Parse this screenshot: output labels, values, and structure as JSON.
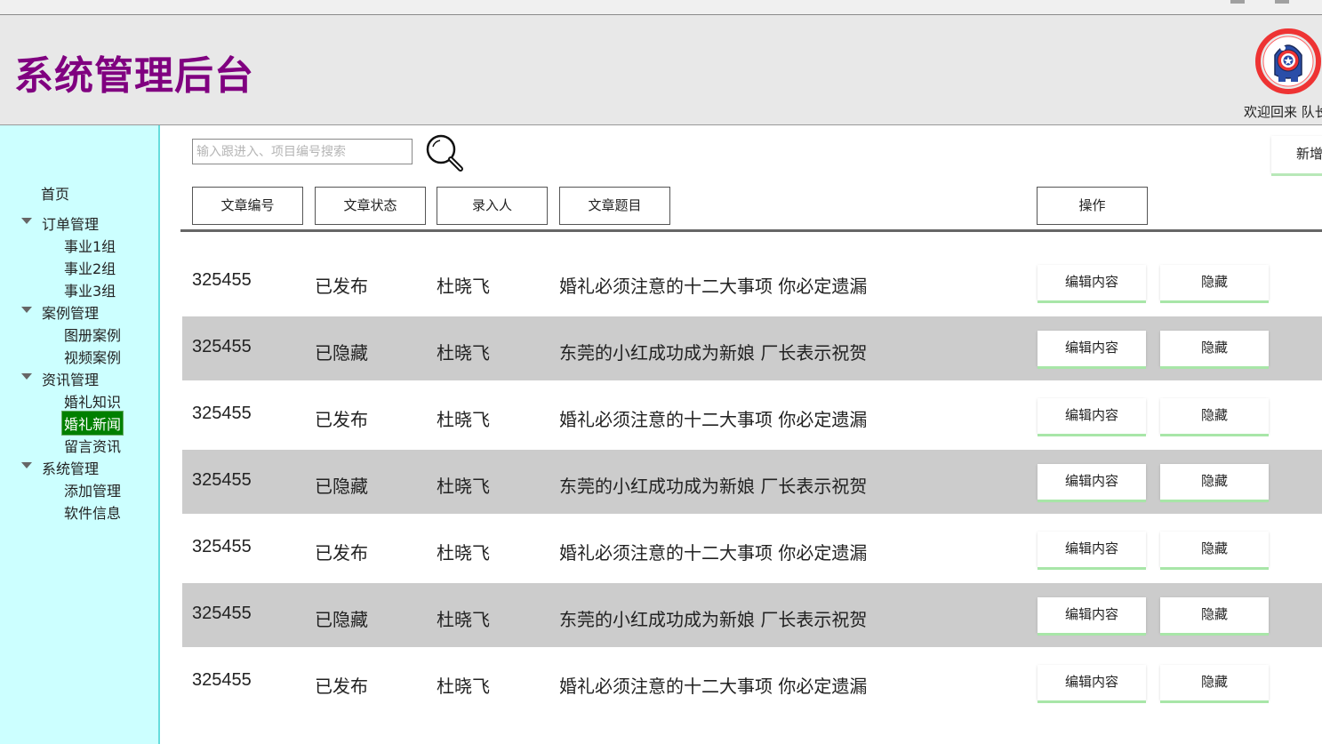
{
  "header": {
    "title": "系统管理后台",
    "welcome": "欢迎回来 队长"
  },
  "sidebar": {
    "home": "首页",
    "groups": [
      {
        "label": "订单管理",
        "items": [
          "事业1组",
          "事业2组",
          "事业3组"
        ]
      },
      {
        "label": "案例管理",
        "items": [
          "图册案例",
          "视频案例"
        ]
      },
      {
        "label": "资讯管理",
        "items": [
          "婚礼知识",
          "婚礼新闻",
          "留言资讯"
        ]
      },
      {
        "label": "系统管理",
        "items": [
          "添加管理",
          "软件信息"
        ]
      }
    ],
    "active_item": "婚礼新闻"
  },
  "search": {
    "placeholder": "输入跟进入、项目编号搜索",
    "value": ""
  },
  "toolbar": {
    "add_label": "新增"
  },
  "table": {
    "headers": [
      "文章编号",
      "文章状态",
      "录入人",
      "文章题目"
    ],
    "action_header": "操作",
    "edit_label": "编辑内容",
    "hide_label": "隐藏",
    "rows": [
      {
        "id": "325455",
        "status": "已发布",
        "author": "杜晓飞",
        "title": "婚礼必须注意的十二大事项 你必定遗漏"
      },
      {
        "id": "325455",
        "status": "已隐藏",
        "author": "杜晓飞",
        "title": "东莞的小红成功成为新娘 厂长表示祝贺"
      },
      {
        "id": "325455",
        "status": "已发布",
        "author": "杜晓飞",
        "title": "婚礼必须注意的十二大事项 你必定遗漏"
      },
      {
        "id": "325455",
        "status": "已隐藏",
        "author": "杜晓飞",
        "title": "东莞的小红成功成为新娘 厂长表示祝贺"
      },
      {
        "id": "325455",
        "status": "已发布",
        "author": "杜晓飞",
        "title": "婚礼必须注意的十二大事项 你必定遗漏"
      },
      {
        "id": "325455",
        "status": "已隐藏",
        "author": "杜晓飞",
        "title": "东莞的小红成功成为新娘 厂长表示祝贺"
      },
      {
        "id": "325455",
        "status": "已发布",
        "author": "杜晓飞",
        "title": "婚礼必须注意的十二大事项 你必定遗漏"
      }
    ]
  },
  "colors": {
    "title": "#800080",
    "sidebar_bg": "#ccffff",
    "active_item_bg": "#008000",
    "alt_row_bg": "#cccccc",
    "button_shadow": "#a8e6a8"
  },
  "icons": {
    "avatar": "captain-america-shield-avatar",
    "search": "magnifier-icon",
    "expand": "triangle-down-icon"
  }
}
